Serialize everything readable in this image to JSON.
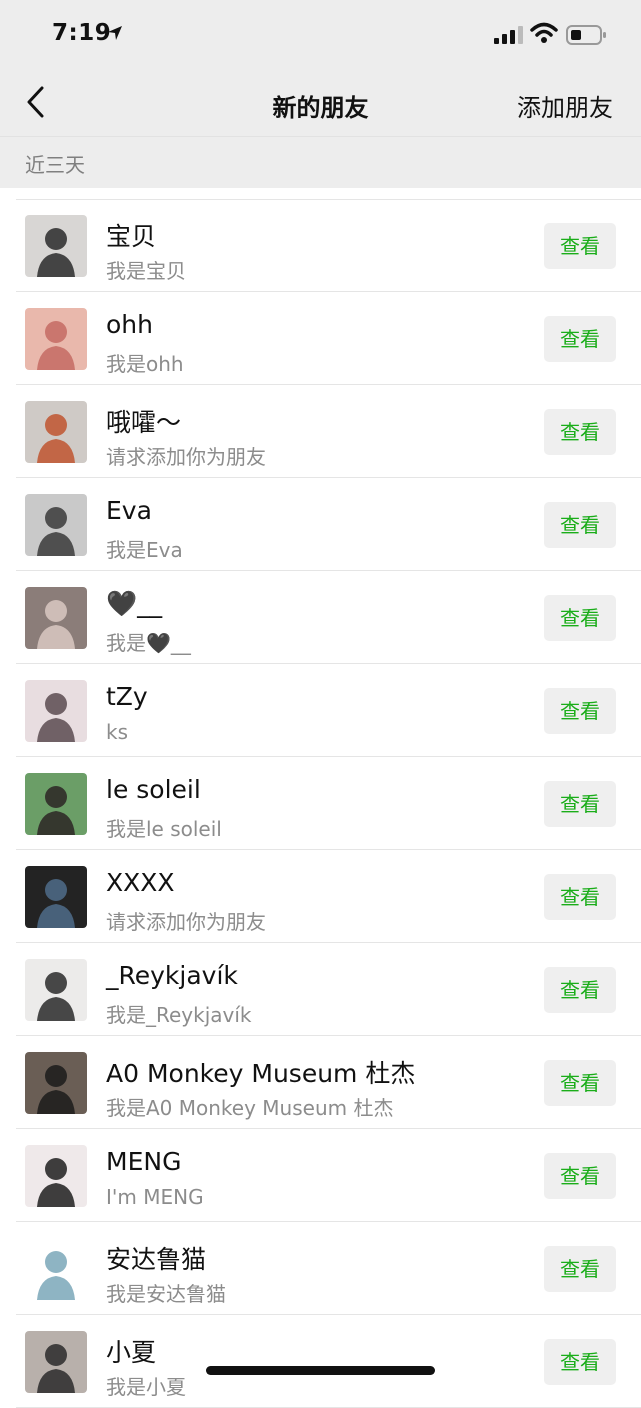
{
  "status": {
    "time": "7:19"
  },
  "nav": {
    "title": "新的朋友",
    "action": "添加朋友"
  },
  "section": {
    "label": "近三天"
  },
  "view_label": "查看",
  "colors": {
    "accent": "#1aad19",
    "background": "#ededed"
  },
  "items": [
    {
      "name": "宝贝",
      "sub": "我是宝贝",
      "avatar": {
        "bg": "#d8d6d4",
        "fg": "#2a2a2a"
      }
    },
    {
      "name": "ohh",
      "sub": "我是ohh",
      "avatar": {
        "bg": "#e9b8ac",
        "fg": "#c46a63"
      }
    },
    {
      "name": "哦嚯～",
      "sub": "请求添加你为朋友",
      "avatar": {
        "bg": "#cfcac6",
        "fg": "#c0552f"
      }
    },
    {
      "name": "Eva",
      "sub": "我是Eva",
      "avatar": {
        "bg": "#c9c9c9",
        "fg": "#3a3a3a"
      }
    },
    {
      "name": "🖤__",
      "sub": "我是🖤__",
      "avatar": {
        "bg": "#8b7d79",
        "fg": "#d9c8c2"
      }
    },
    {
      "name": "tZy",
      "sub": "ks",
      "avatar": {
        "bg": "#e8dde0",
        "fg": "#5a4b50"
      }
    },
    {
      "name": "le soleil",
      "sub": "我是le soleil",
      "avatar": {
        "bg": "#6b9e67",
        "fg": "#2c2424"
      }
    },
    {
      "name": "XXXX",
      "sub": "请求添加你为朋友",
      "avatar": {
        "bg": "#232323",
        "fg": "#4f6c8a"
      }
    },
    {
      "name": "_Reykjavík",
      "sub": "我是_Reykjavík",
      "avatar": {
        "bg": "#ecebea",
        "fg": "#2a2a2a"
      }
    },
    {
      "name": "A0 Monkey Museum 杜杰",
      "sub": "我是A0 Monkey Museum 杜杰",
      "avatar": {
        "bg": "#6a5e55",
        "fg": "#1b1b1b"
      }
    },
    {
      "name": "MENG",
      "sub": "I'm MENG",
      "avatar": {
        "bg": "#efe9ea",
        "fg": "#1e1e1e"
      }
    },
    {
      "name": "安达鲁猫",
      "sub": "我是安达鲁猫",
      "avatar": {
        "bg": "#ffffff",
        "fg": "#7aa7b8"
      }
    },
    {
      "name": "小夏",
      "sub": "我是小夏",
      "avatar": {
        "bg": "#b8b0ab",
        "fg": "#2a2a2a"
      }
    }
  ]
}
